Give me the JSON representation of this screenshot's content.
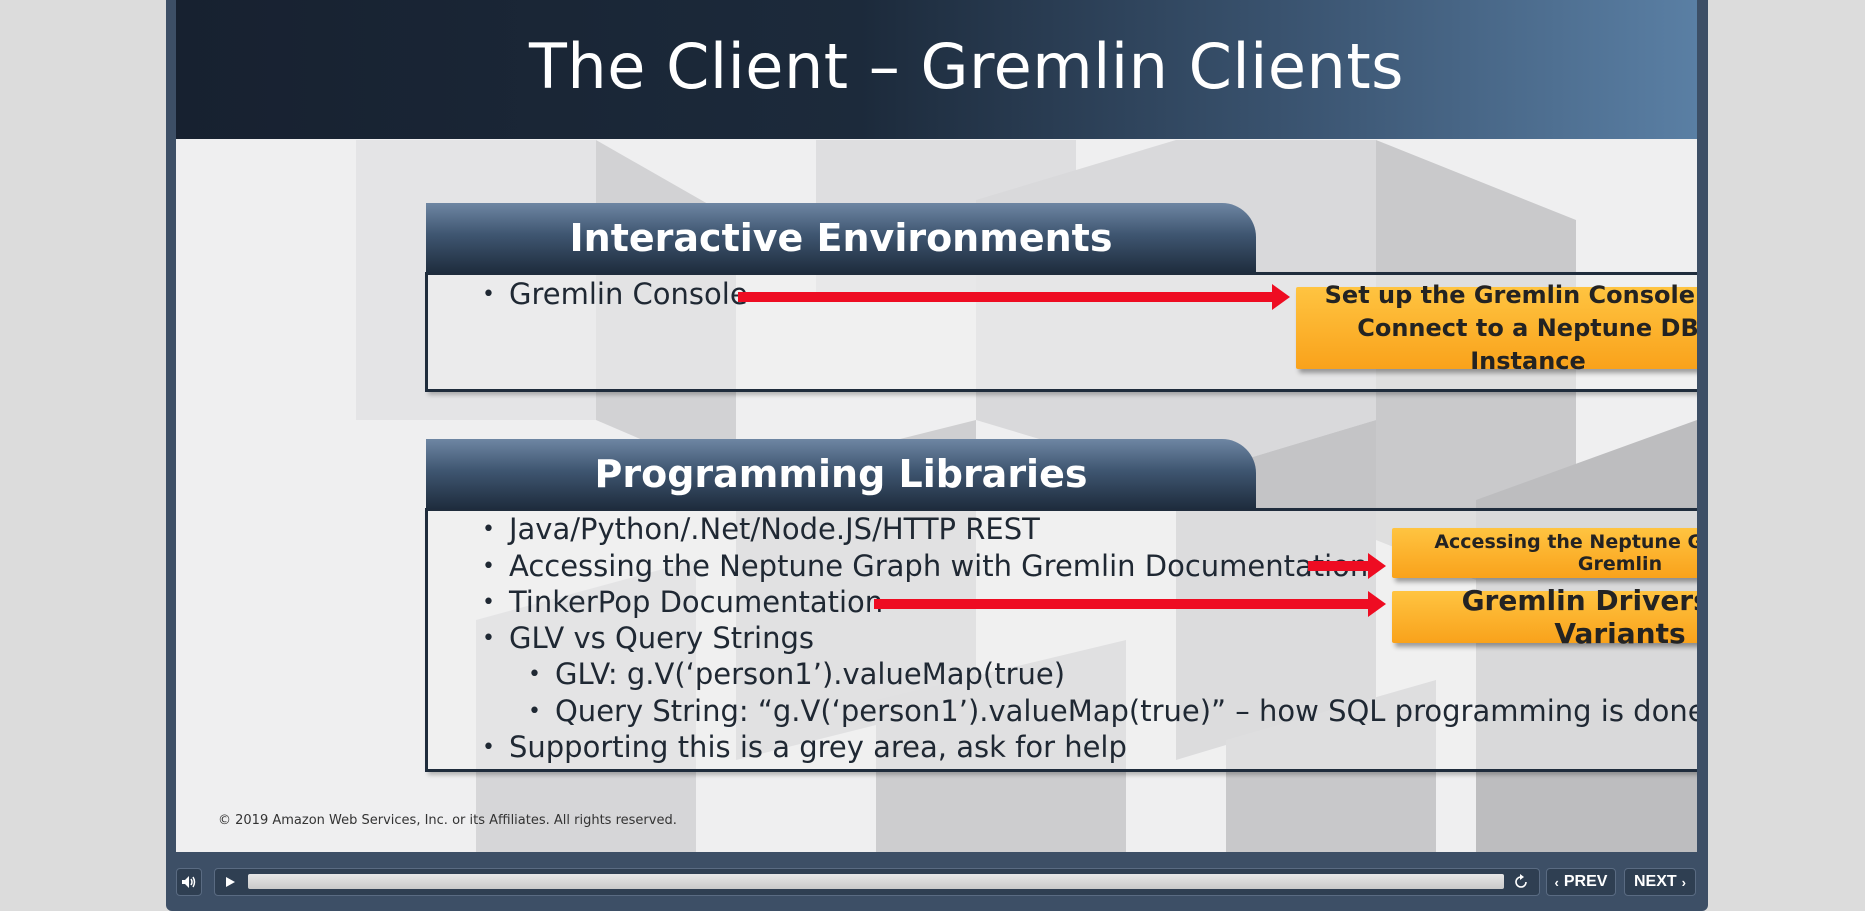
{
  "slide": {
    "title": "The Client – Gremlin Clients",
    "copyright": "© 2019 Amazon Web Services, Inc. or its Affiliates. All rights reserved."
  },
  "interactive_section": {
    "heading": "Interactive Environments",
    "bullets": [
      "Gremlin Console"
    ],
    "callout": "Set up the Gremlin Console to Connect to a Neptune DB Instance"
  },
  "programming_section": {
    "heading": "Programming Libraries",
    "bullets": [
      "Java/Python/.Net/Node.JS/HTTP REST",
      "Accessing the Neptune Graph with Gremlin Documentation",
      "TinkerPop Documentation",
      "GLV vs Query Strings",
      "GLV: g.V(‘person1’).valueMap(true)",
      "Query String: “g.V(‘person1’).valueMap(true)” – how SQL programming is done",
      "Supporting this is a grey area, ask for help"
    ],
    "callouts": [
      "Accessing the Neptune Graph with Gremlin",
      "Gremlin Drivers and Variants"
    ]
  },
  "controls": {
    "volume_icon": "speaker-icon",
    "play_icon": "play-icon",
    "replay_icon": "replay-icon",
    "prev_label": "PREV",
    "next_label": "NEXT",
    "progress": 0.99
  },
  "colors": {
    "accent_orange": "#f9a21b",
    "arrow_red": "#ee0c22",
    "title_dark": "#172130"
  }
}
